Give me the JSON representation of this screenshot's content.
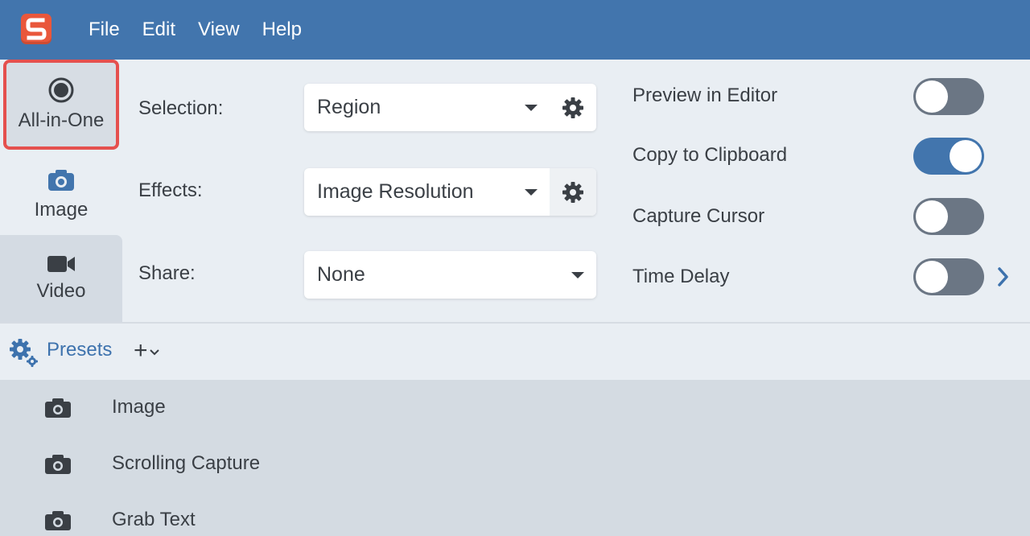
{
  "menubar": {
    "logo_letter": "S",
    "items": [
      "File",
      "Edit",
      "View",
      "Help"
    ]
  },
  "modes": [
    {
      "label": "All-in-One",
      "icon": "record-icon",
      "selected": true
    },
    {
      "label": "Image",
      "icon": "camera-icon"
    },
    {
      "label": "Video",
      "icon": "video-camera-icon"
    }
  ],
  "settings": {
    "selection": {
      "label": "Selection:",
      "value": "Region"
    },
    "effects": {
      "label": "Effects:",
      "value": "Image Resolution"
    },
    "share": {
      "label": "Share:",
      "value": "None"
    }
  },
  "options": [
    {
      "label": "Preview in Editor",
      "on": false
    },
    {
      "label": "Copy to Clipboard",
      "on": true
    },
    {
      "label": "Capture Cursor",
      "on": false
    },
    {
      "label": "Time Delay",
      "on": false
    }
  ],
  "presets": {
    "label": "Presets",
    "add_label": "+",
    "items": [
      "Image",
      "Scrolling Capture",
      "Grab Text"
    ]
  },
  "colors": {
    "menubar": "#4275ad",
    "accent": "#3d72ad",
    "highlight_border": "#e5504e",
    "logo": "#e9573b"
  }
}
